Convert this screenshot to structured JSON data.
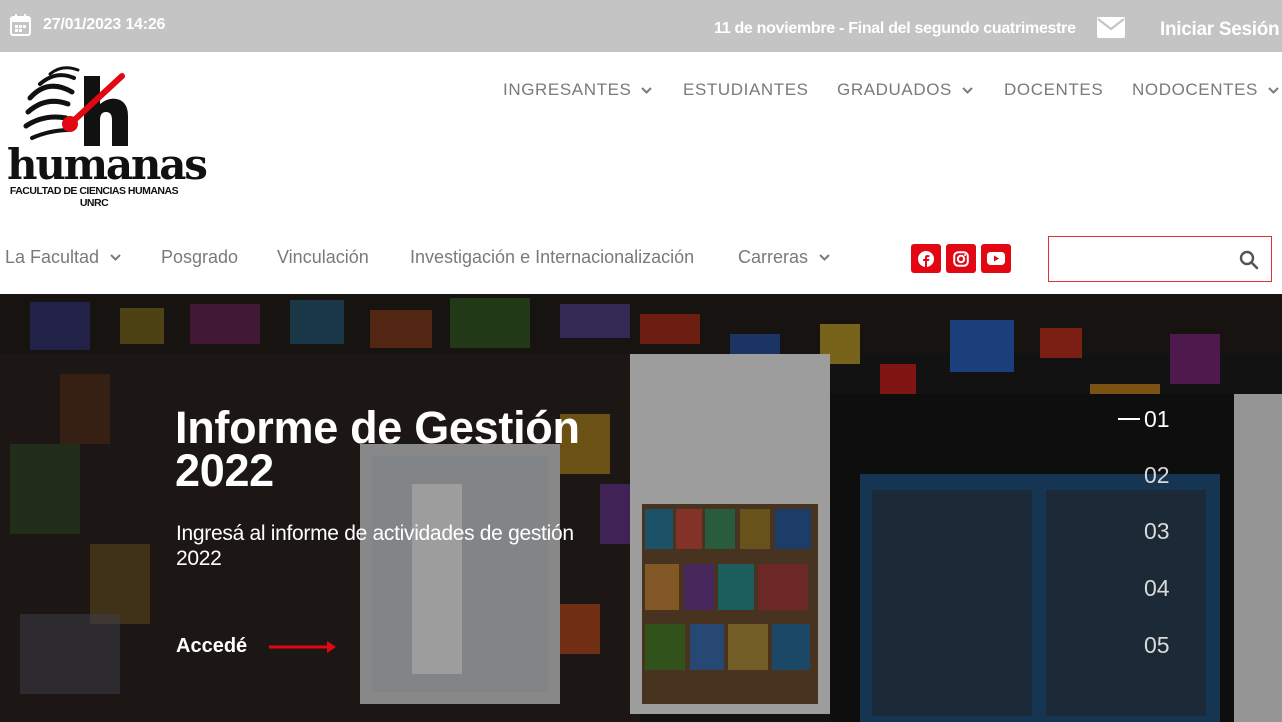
{
  "topbar": {
    "date": "27/01/2023 14:26",
    "notice": "11 de noviembre - Final del segundo cuatrimestre",
    "login": "Iniciar Sesión",
    "icons": {
      "calendar": "calendar-icon",
      "mail": "envelope-icon"
    },
    "background_color": "#c4c4c4"
  },
  "logo": {
    "word": "humanas",
    "subtitle_line1": "FACULTAD DE CIENCIAS HUMANAS",
    "subtitle_line2": "UNRC"
  },
  "primary_nav": [
    {
      "label": "INGRESANTES",
      "has_dropdown": true
    },
    {
      "label": "ESTUDIANTES",
      "has_dropdown": false
    },
    {
      "label": "GRADUADOS",
      "has_dropdown": true
    },
    {
      "label": "DOCENTES",
      "has_dropdown": false
    },
    {
      "label": "NODOCENTES",
      "has_dropdown": true
    }
  ],
  "secondary_nav": [
    {
      "label": "La Facultad",
      "has_dropdown": true
    },
    {
      "label": "Posgrado",
      "has_dropdown": false
    },
    {
      "label": "Vinculación",
      "has_dropdown": false
    },
    {
      "label": "Investigación e Internacionalización",
      "has_dropdown": false
    },
    {
      "label": "Carreras",
      "has_dropdown": true
    }
  ],
  "social": {
    "icons": [
      "facebook-icon",
      "instagram-icon",
      "youtube-icon"
    ],
    "color": "#e30613"
  },
  "search": {
    "value": "",
    "placeholder": "",
    "icon": "search-icon",
    "border_color": "#e0303a"
  },
  "hero": {
    "title": "Informe de Gestión 2022",
    "subtitle": "Ingresá al informe de actividades de gestión 2022",
    "cta_label": "Accedé",
    "cta_arrow_color": "#e30613",
    "slides": [
      "01",
      "02",
      "03",
      "04",
      "05"
    ],
    "active_slide": "01"
  }
}
